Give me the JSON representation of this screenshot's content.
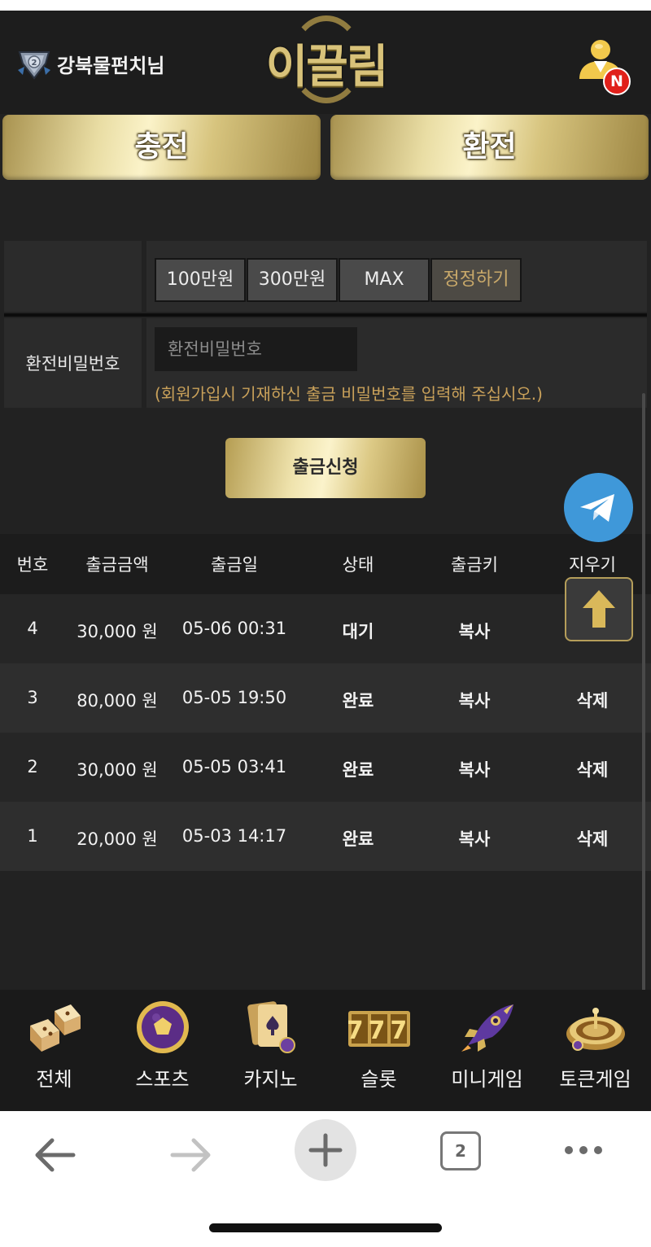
{
  "header": {
    "username": "강북물펀치님",
    "logo_text": "이끌림",
    "notification_badge": "N"
  },
  "actions": {
    "charge_label": "충전",
    "exchange_label": "환전"
  },
  "form": {
    "amount_buttons": [
      "100만원",
      "300만원",
      "MAX",
      "정정하기"
    ],
    "password_label": "환전비밀번호",
    "password_placeholder": "환전비밀번호",
    "password_hint": "(회원가입시 기재하신 출금 비밀번호를 입력해 주십시오.)",
    "submit_label": "출금신청"
  },
  "table": {
    "headers": [
      "번호",
      "출금금액",
      "출금일",
      "상태",
      "출금키",
      "지우기"
    ],
    "rows": [
      {
        "no": "4",
        "amount": "30,000 원",
        "date": "05-06 00:31",
        "status": "대기",
        "key": "복사",
        "delete": ""
      },
      {
        "no": "3",
        "amount": "80,000 원",
        "date": "05-05 19:50",
        "status": "완료",
        "key": "복사",
        "delete": "삭제"
      },
      {
        "no": "2",
        "amount": "30,000 원",
        "date": "05-05 03:41",
        "status": "완료",
        "key": "복사",
        "delete": "삭제"
      },
      {
        "no": "1",
        "amount": "20,000 원",
        "date": "05-03 14:17",
        "status": "완료",
        "key": "복사",
        "delete": "삭제"
      }
    ]
  },
  "bottom_menu": [
    {
      "label": "전체",
      "icon": "dice-icon"
    },
    {
      "label": "스포츠",
      "icon": "soccer-ball-icon"
    },
    {
      "label": "카지노",
      "icon": "playing-cards-icon"
    },
    {
      "label": "슬롯",
      "icon": "slot-777-icon"
    },
    {
      "label": "미니게임",
      "icon": "rocket-icon"
    },
    {
      "label": "토큰게임",
      "icon": "roulette-icon"
    }
  ],
  "slot_icon_text": "777",
  "browser": {
    "tab_count": "2"
  },
  "colors": {
    "gold": "#d8c27a",
    "hint": "#c9a15a",
    "telegram": "#3f98d9",
    "badge_red": "#e0201a"
  }
}
